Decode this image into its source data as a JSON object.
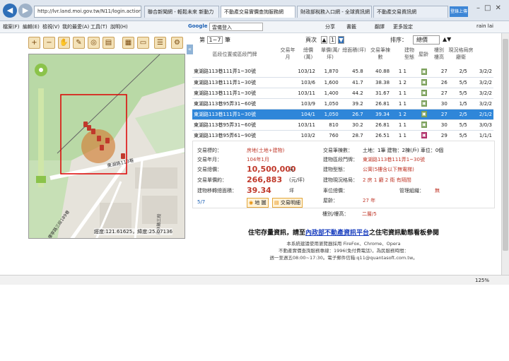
{
  "browser": {
    "address": "http://lvr.land.moi.gov.tw/N11/login.action",
    "tabs": [
      "聯合新聞網 - 輕鬆未來 新動力",
      "不動產交易實價查詢服務網",
      "財政部稅務入口網 - 全球資訊網",
      "房地產交易網站",
      "不動產交易資訊網"
    ],
    "menus": [
      "檔案(F)",
      "編輯(E)",
      "檢視(V)",
      "我的最愛(A)",
      "工具(T)",
      "說明(H)"
    ],
    "google_label": "Google",
    "google_value": "雲儀登入",
    "toolbar_extra": [
      "搜尋",
      "分享",
      "書籤",
      "翻譯",
      "更多設定"
    ],
    "user": "rain lai",
    "zoom": "125%",
    "right_btn": "登錄上傳"
  },
  "map": {
    "coords": "經度:121.61625，緯度:25.07136",
    "streets": [
      "東湖路113巷",
      "康寧路三段189巷",
      "康寧路三段"
    ]
  },
  "list": {
    "page_prefix": "第",
    "page_value": "1~7",
    "page_suffix": "筆",
    "page_label": "頁次",
    "page_num": "1",
    "sort_label": "排序：",
    "sort_value": "總價",
    "headers": [
      "區段位置或區段門牌",
      "交易年月",
      "總價(萬)",
      "單價(萬/坪)",
      "總面積(坪)",
      "交易筆棟數",
      "建物型態",
      "屋齡",
      "樓別樓高",
      "現況格局房廳衛"
    ],
    "rows": [
      {
        "addr": "東湖路113巷111弄1~30號",
        "ym": "103/12",
        "total": "1,870",
        "unit": "45.8",
        "area": "40.88",
        "cnt": "1 1",
        "age": "27",
        "floor": "2/5",
        "layout": "3/2/2",
        "type_color": "#7ba05b",
        "sel": false
      },
      {
        "addr": "東湖路113巷111弄1~30號",
        "ym": "103/6",
        "total": "1,600",
        "unit": "41.7",
        "area": "38.38",
        "cnt": "1 2",
        "age": "26",
        "floor": "5/5",
        "layout": "3/2/2",
        "type_color": "#7ba05b",
        "sel": false
      },
      {
        "addr": "東湖路113巷111弄1~30號",
        "ym": "103/11",
        "total": "1,400",
        "unit": "44.2",
        "area": "31.67",
        "cnt": "1 1",
        "age": "27",
        "floor": "5/5",
        "layout": "3/2/2",
        "type_color": "#7ba05b",
        "sel": false
      },
      {
        "addr": "東湖路113巷95弄31~60號",
        "ym": "103/9",
        "total": "1,050",
        "unit": "39.2",
        "area": "26.81",
        "cnt": "1 1",
        "age": "30",
        "floor": "1/5",
        "layout": "3/2/2",
        "type_color": "#7ba05b",
        "sel": false
      },
      {
        "addr": "東湖路113巷111弄1~30號",
        "ym": "104/1",
        "total": "1,050",
        "unit": "26.7",
        "area": "39.34",
        "cnt": "1 2",
        "age": "27",
        "floor": "2/5",
        "layout": "2/1/2",
        "type_color": "#7ba05b",
        "sel": true
      },
      {
        "addr": "東湖路113巷95弄31~60號",
        "ym": "103/11",
        "total": "810",
        "unit": "30.2",
        "area": "26.81",
        "cnt": "1 1",
        "age": "30",
        "floor": "5/5",
        "layout": "3/0/3",
        "type_color": "#7ba05b",
        "sel": false
      },
      {
        "addr": "東湖路113巷95弄61~90號",
        "ym": "103/2",
        "total": "760",
        "unit": "28.7",
        "area": "26.51",
        "cnt": "1 1",
        "age": "29",
        "floor": "5/5",
        "layout": "1/1/1",
        "type_color": "#b0306a",
        "sel": false
      }
    ]
  },
  "detail": {
    "labels": [
      "交易標的：",
      "交易年月：",
      "交易總價：",
      "交易單價約：",
      "建物移轉總面積："
    ],
    "values": [
      "房地(土地+建物)",
      "104年1月",
      "10,500,000",
      "266,883",
      "39.34"
    ],
    "units": [
      "",
      "",
      "元",
      "(元/坪)",
      "坪"
    ],
    "pager": "5/7",
    "map_btn": "地 圖",
    "detail_btn": "交易明細",
    "right_labels": [
      "交易筆棟數：",
      "建物區段門牌：",
      "建物型態：",
      "建物現況格局：",
      "車位總價：",
      "屋齡：",
      "樓別/樓高："
    ],
    "right_values": [
      "土地：1筆 建物：2棟(戶) 車位：0個",
      "東湖路113巷111弄1~30號",
      "公寓(5樓含以下無電梯)",
      "2 房 1 廳 2 衛 有隔間",
      "",
      "27 年",
      "二層/5"
    ],
    "mgmt_label": "管理組織：",
    "mgmt_value": "無"
  },
  "notice": {
    "pre": "住宅存量資訊，請至",
    "link": "內政部不動產資訊平台",
    "post": "之住宅資訊動態看板參閱"
  },
  "footer": [
    "本系統建議使用瀏覽器採用 FireFox、Chrome、Opera",
    "不動產實價查詢服務專線：1996(免付費電話)，為民服務時間：",
    "週一至週五08:00~17:30。電子郵件信箱:q11@quantasoft.com.tw。"
  ]
}
